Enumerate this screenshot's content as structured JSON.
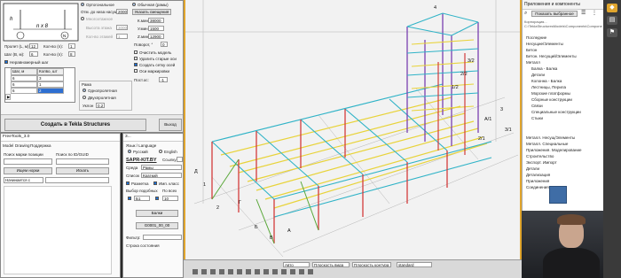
{
  "top_left_panel": {
    "diagram": {
      "label_center": "n x 8",
      "label_h": "h",
      "label_n": "N"
    },
    "fields": {
      "rows_label": "Пролет (L, м):",
      "rows_value": "12",
      "step_label": "Шаг (B, м):",
      "step_value": "6",
      "qty_label": "Кол-во (n):",
      "qty_value": "1",
      "qty2_label": "Кол-во (n):",
      "qty2_value": "8",
      "uneven_label": "Неравномерный шаг"
    },
    "table": {
      "headers": [
        "",
        "Шаг, м",
        "Колво, шт"
      ],
      "rows": [
        [
          "",
          "6",
          "3"
        ],
        [
          "",
          "6",
          "1"
        ],
        [
          "",
          "6",
          "2"
        ],
        [
          "▶",
          "",
          ""
        ]
      ]
    },
    "middle": {
      "ortho": "Ортогональное",
      "offset_label": "Отм. до низа насущ.",
      "offset_value": "2000",
      "multistorey": "Многоэтажное",
      "floor_height_label": "Высота этажа",
      "floor_height_value": "3000",
      "floor_count_label": "Кол-во этажей",
      "floor_count_value": "1",
      "frame_label": "Рама",
      "single_span": "Однопролетная",
      "double_span": "Двухпролетная",
      "slope_label": "Уклон",
      "slope_value": "0,2"
    },
    "right": {
      "normal": "Обычная (рамы)",
      "offsets_btn": "Указать смещения",
      "kmin_label": "К.мин",
      "kmin_value": "38000",
      "ymin_label": "У.мин",
      "ymin_value": "1500",
      "zmin_label": "Z.мин",
      "zmin_value": "12900",
      "rotation_label": "Поворот, °",
      "rotation_value": "0",
      "clear_model": "Очистить модель",
      "delete_old": "Удалить старые оси",
      "create_grid": "Создать сетку осей",
      "axis_marking": "Оси маркировки",
      "level_label": "Пост.ос:",
      "level_value": "-1"
    },
    "create_button": "Создать в Tekla Structures",
    "exit_button": "Выход"
  },
  "find_panel": {
    "title": "FreeTools_3.0",
    "tabs": [
      "Model",
      "Drawing",
      "Поддержка"
    ],
    "search_pos_label": "Поиск марки позиции",
    "search_id_label": "Поиск по ID/GUID",
    "find_btn": "Ищем норки",
    "search_btn": "Искать",
    "start_dropdown": "Начинается с"
  },
  "lang_panel": {
    "title": "3...",
    "lang_label": "Язык / Language",
    "ru": "Русский",
    "en": "English",
    "brand": "SAPR-KIT.BY",
    "links_label": "Ссылку",
    "env_label": "Среда",
    "env_value": "Рамы",
    "list_label": "Список",
    "list_value": "Краткий",
    "check1": "Разметка",
    "check2": "Имп. класс",
    "select_label": "Выбор подобных",
    "select_value": "По всех",
    "val1": "Б1",
    "val2": "10",
    "btn_apply": "Балки",
    "code_value": "G0001_00_00",
    "filter_label": "Фильтр:",
    "status_label": "Строка состояния"
  },
  "status_bar": {
    "items": [
      "Авто",
      "Плоскость вида",
      "Плоскость контура",
      "standard"
    ]
  },
  "right_panel": {
    "title": "Приложения и компоненты",
    "search_btn": "Показать выбранное",
    "path": "Корпорация... C:\\TeklaStructuresModels\\Components\\ComponentCatalog.xml",
    "items": [
      {
        "label": "Последние",
        "sub": false
      },
      {
        "label": "Несущие/Элементы",
        "sub": false
      },
      {
        "label": "Бетон",
        "sub": false
      },
      {
        "label": "Бетон. Несущий/Элементы",
        "sub": false
      },
      {
        "label": "Металл",
        "sub": false
      },
      {
        "label": "Балка - Балка",
        "sub": true
      },
      {
        "label": "Детали",
        "sub": true
      },
      {
        "label": "Колонна - Балка",
        "sub": true
      },
      {
        "label": "Лестницы, Перила",
        "sub": true
      },
      {
        "label": "Морские платформы",
        "sub": true
      },
      {
        "label": "Сборные конструкции",
        "sub": true
      },
      {
        "label": "Связи",
        "sub": true
      },
      {
        "label": "Специальные конструкции",
        "sub": true
      },
      {
        "label": "Стыки",
        "sub": true
      },
      {
        "label": "Металл. Несущ/Элементы",
        "sub": false
      },
      {
        "label": "Металл. Специальные",
        "sub": false
      },
      {
        "label": "Приложения. Моделирование",
        "sub": false
      },
      {
        "label": "Строительство",
        "sub": false
      },
      {
        "label": "Экспорт. Импорт",
        "sub": false
      },
      {
        "label": "Детали",
        "sub": false
      },
      {
        "label": "Детализация",
        "sub": false
      },
      {
        "label": "Приложения",
        "sub": false
      },
      {
        "label": "Соединения",
        "sub": false
      }
    ]
  },
  "viewport": {
    "axis_labels": [
      "А/1",
      "2/1",
      "3/1",
      "3",
      "4",
      "1",
      "2",
      "Б",
      "В",
      "Г",
      "Д",
      "А",
      "1/2",
      "2/2",
      "3/2"
    ]
  },
  "colors": {
    "accent": "#e0a52d",
    "column_red": "#d23b3b",
    "column_purple": "#7a3fb0",
    "beam_cyan": "#2fb3c7",
    "beam_yellow": "#e8d33a",
    "beam_green": "#5aa83a"
  }
}
